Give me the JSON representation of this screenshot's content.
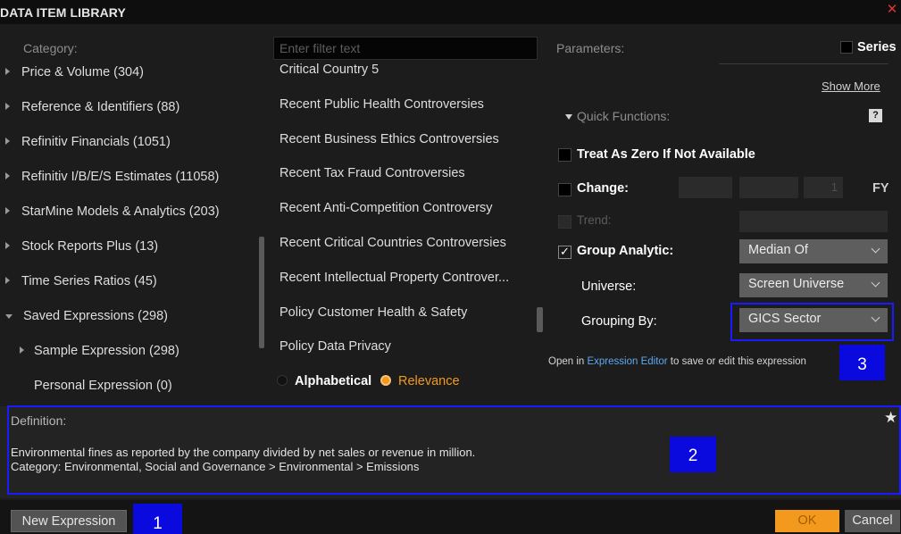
{
  "window": {
    "title": "DATA ITEM LIBRARY",
    "close_icon": "close-icon",
    "close_glyph": "✕"
  },
  "category": {
    "header": "Category:",
    "items": [
      {
        "label": "Price & Volume (304)",
        "expanded": false
      },
      {
        "label": "Reference & Identifiers (88)",
        "expanded": false
      },
      {
        "label": "Refinitiv Financials (1051)",
        "expanded": false
      },
      {
        "label": "Refinitiv I/B/E/S Estimates (11058)",
        "expanded": false
      },
      {
        "label": "StarMine Models & Analytics (203)",
        "expanded": false
      },
      {
        "label": "Stock Reports Plus (13)",
        "expanded": false
      },
      {
        "label": "Time Series Ratios (45)",
        "expanded": false
      },
      {
        "label": "Saved Expressions (298)",
        "expanded": true
      },
      {
        "label": "Sample Expression (298)",
        "expanded": false
      },
      {
        "label": "Personal Expression (0)",
        "expanded": false
      }
    ]
  },
  "filter": {
    "placeholder": "Enter filter text",
    "value": ""
  },
  "list": {
    "items": [
      "Critical Country 5",
      "Recent Public Health Controversies",
      "Recent Business Ethics Controversies",
      "Recent Tax Fraud Controversies",
      "Recent Anti-Competition Controversy",
      "Recent Critical Countries Controversies",
      "Recent Intellectual Property Controver...",
      "Policy Customer Health & Safety",
      "Policy Data Privacy"
    ],
    "sort_alpha": "Alphabetical",
    "sort_relevance": "Relevance",
    "sort_selected": "Relevance"
  },
  "params": {
    "header": "Parameters:",
    "series_label": "Series",
    "show_more": "Show More",
    "quick_functions": "Quick Functions:",
    "help_label": "?",
    "treat_zero": {
      "label": "Treat As Zero If Not Available",
      "checked": false
    },
    "change": {
      "label": "Change:",
      "checked": false,
      "period_value": "1",
      "fy_label": "FY"
    },
    "trend": {
      "label": "Trend:",
      "checked": false
    },
    "group_analytic": {
      "label": "Group Analytic:",
      "checked": true,
      "value": "Median Of"
    },
    "universe": {
      "label": "Universe:",
      "value": "Screen Universe"
    },
    "grouping_by": {
      "label": "Grouping By:",
      "value": "GICS Sector"
    },
    "editor_note": {
      "prefix": "Open in ",
      "link": "Expression Editor",
      "suffix": " to save or edit this expression"
    }
  },
  "definition": {
    "header": "Definition:",
    "line1": "Environmental fines as reported by the company divided by net sales or revenue in million.",
    "line2": "Category: Environmental, Social and Governance > Environmental > Emissions",
    "star_glyph": "★"
  },
  "footer": {
    "new_expression": "New Expression",
    "ok": "OK",
    "cancel": "Cancel"
  },
  "annotations": {
    "marker1": "1",
    "marker2": "2",
    "marker3": "3"
  },
  "colors": {
    "accent": "#f39a1e",
    "link": "#5ea8f0",
    "annotation": "#0a0adf",
    "close": "#e03535"
  }
}
